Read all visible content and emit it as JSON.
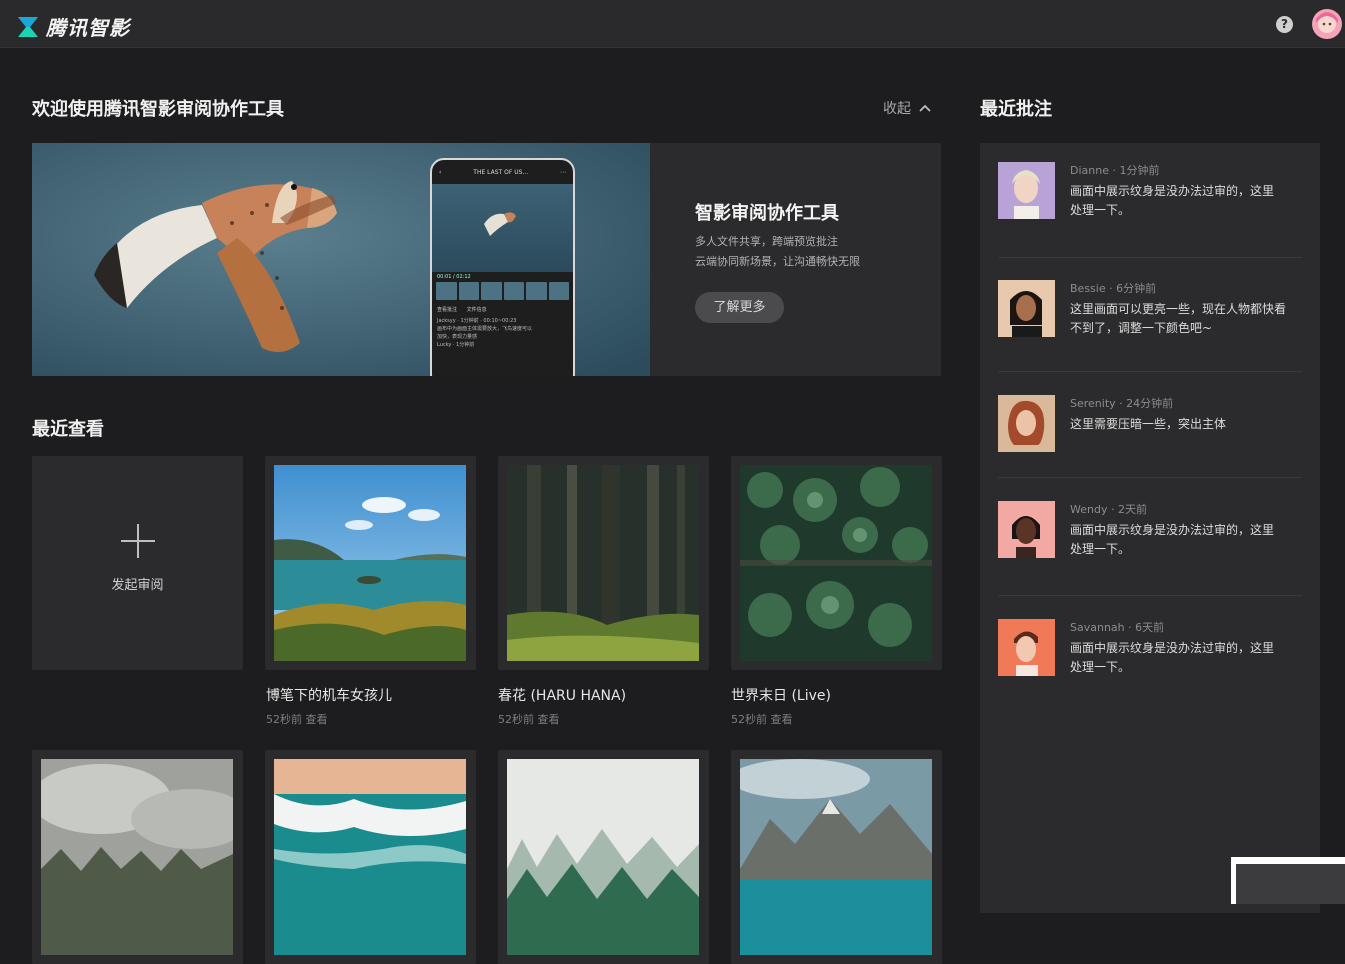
{
  "header": {
    "logo_text": "腾讯智影",
    "help_glyph": "?"
  },
  "welcome": {
    "title": "欢迎使用腾讯智影审阅协作工具",
    "collapse_label": "收起",
    "banner": {
      "title": "智影审阅协作工具",
      "desc_line1": "多人文件共享，跨端预览批注",
      "desc_line2": "云端协同新场景，让沟通畅快无限",
      "button": "了解更多",
      "phone": {
        "title": "THE LAST OF US...",
        "time": "00:01 / 02:12",
        "tab1": "查看批注",
        "tab2": "文件信息",
        "comment_user": "Jacksyy · 1分钟前 · 00:10~00:23",
        "comment_text_1": "画布中为画面主体需要放大，飞鸟速度可以",
        "comment_text_2": "加快，表现力量感",
        "reply_user": "Lucky · 1分钟前"
      }
    }
  },
  "recent": {
    "title": "最近查看",
    "new_label": "发起审阅",
    "items": [
      {
        "title": "博笔下的机车女孩儿",
        "meta": "52秒前 查看"
      },
      {
        "title": "春花 (HARU HANA)",
        "meta": "52秒前 查看"
      },
      {
        "title": "世界末日 (Live)",
        "meta": "52秒前 查看"
      }
    ]
  },
  "comments": {
    "title": "最近批注",
    "items": [
      {
        "user": "Dianne",
        "time": "1分钟前",
        "line1": "画面中展示纹身是没办法过审的，这里",
        "line2": "处理一下。"
      },
      {
        "user": "Bessie",
        "time": "6分钟前",
        "line1": "这里画面可以更亮一些，现在人物都快看",
        "line2": "不到了，调整一下颜色吧~"
      },
      {
        "user": "Serenity",
        "time": "24分钟前",
        "line1": "这里需要压暗一些，突出主体",
        "line2": ""
      },
      {
        "user": "Wendy",
        "time": "2天前",
        "line1": "画面中展示纹身是没办法过审的，这里",
        "line2": "处理一下。"
      },
      {
        "user": "Savannah",
        "time": "6天前",
        "line1": "画面中展示纹身是没办法过审的，这里",
        "line2": "处理一下。"
      }
    ]
  },
  "colors": {
    "background": "#1d1d1f",
    "panel": "#2b2b2d",
    "topbar": "#2a2a2c",
    "logo_accent": "#19d3b3"
  }
}
